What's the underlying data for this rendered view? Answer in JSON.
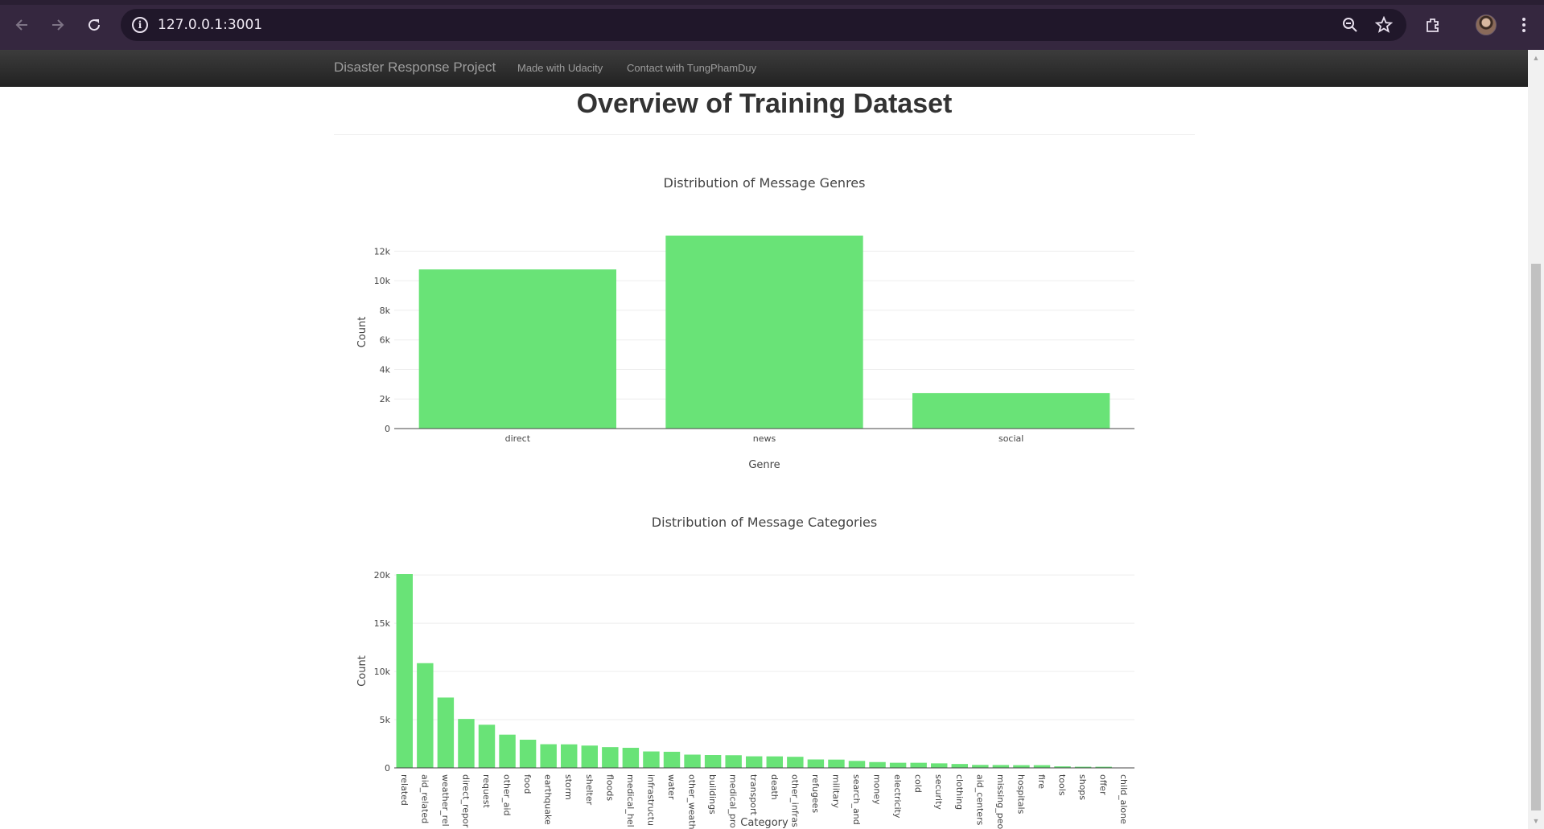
{
  "browser": {
    "url": "127.0.0.1:3001"
  },
  "navbar": {
    "brand": "Disaster Response Project",
    "links": [
      "Made with Udacity",
      "Contact with TungPhamDuy"
    ]
  },
  "page": {
    "title": "Overview of Training Dataset"
  },
  "colors": {
    "bar": "#69e377",
    "navbar": "#222222",
    "chrome": "#35273f"
  },
  "chart_data": [
    {
      "type": "bar",
      "title": "Distribution of Message Genres",
      "xlabel": "Genre",
      "ylabel": "Count",
      "categories": [
        "direct",
        "news",
        "social"
      ],
      "values": [
        10766,
        13054,
        2396
      ],
      "ylim": [
        0,
        13054
      ],
      "yticks": [
        0,
        2000,
        4000,
        6000,
        8000,
        10000,
        12000
      ],
      "ytick_labels": [
        "0",
        "2k",
        "4k",
        "6k",
        "8k",
        "10k",
        "12k"
      ],
      "grid": true
    },
    {
      "type": "bar",
      "title": "Distribution of Message Categories",
      "xlabel": "Category",
      "ylabel": "Count",
      "categories": [
        "related",
        "aid_related",
        "weather_rel",
        "direct_repor",
        "request",
        "other_aid",
        "food",
        "earthquake",
        "storm",
        "shelter",
        "floods",
        "medical_hel",
        "infrastructu",
        "water",
        "other_weath",
        "buildings",
        "medical_pro",
        "transport",
        "death",
        "other_infras",
        "refugees",
        "military",
        "search_and",
        "money",
        "electricity",
        "cold",
        "security",
        "clothing",
        "aid_centers",
        "missing_peo",
        "hospitals",
        "fire",
        "tools",
        "shops",
        "offer",
        "child_alone"
      ],
      "values": [
        20094,
        10860,
        7297,
        5075,
        4474,
        3446,
        2923,
        2455,
        2443,
        2314,
        2155,
        2084,
        1705,
        1672,
        1376,
        1333,
        1313,
        1201,
        1194,
        1151,
        875,
        860,
        724,
        604,
        532,
        530,
        471,
        405,
        309,
        298,
        283,
        282,
        159,
        120,
        118,
        0
      ],
      "ylim": [
        0,
        20094
      ],
      "yticks": [
        0,
        5000,
        10000,
        15000,
        20000
      ],
      "ytick_labels": [
        "0",
        "5k",
        "10k",
        "15k",
        "20k"
      ],
      "grid": true
    }
  ]
}
